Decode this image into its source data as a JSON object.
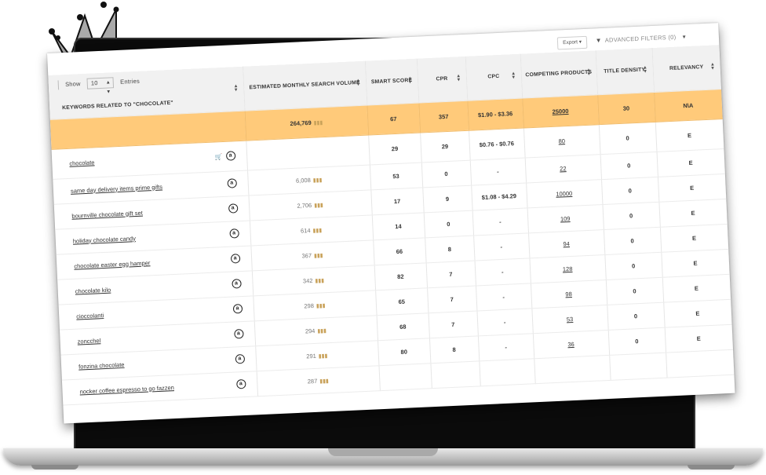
{
  "toolbar": {
    "export_label": "Export",
    "advanced_filters_label": "ADVANCED FILTERS (0)"
  },
  "entries": {
    "show_label": "Show",
    "value": "10",
    "suffix_label": "Entries"
  },
  "columns": [
    "KEYWORDS RELATED TO \"CHOCOLATE\"",
    "ESTIMATED MONTHLY SEARCH VOLUME",
    "SMART SCORE",
    "CPR",
    "CPC",
    "COMPETING PRODUCTS",
    "TITLE DENSITY",
    "RELEVANCY"
  ],
  "summary_row": {
    "keyword": "",
    "volume": "264,769",
    "smart_score": "67",
    "cpr": "357",
    "cpc": "$1.90 - $3.36",
    "competing": "25000",
    "title_density": "30",
    "relevancy": "N\\A"
  },
  "rows": [
    {
      "keyword": "chocolate",
      "volume": "",
      "smart_score": "29",
      "cpr": "29",
      "cpc": "$0.76 - $0.76",
      "competing": "80",
      "title_density": "0",
      "relevancy": "E"
    },
    {
      "keyword": "same day delivery items prime gifts",
      "volume": "6,008",
      "smart_score": "53",
      "cpr": "0",
      "cpc": "-",
      "competing": "22",
      "title_density": "0",
      "relevancy": "E"
    },
    {
      "keyword": "bournville chocolate gift set",
      "volume": "2,706",
      "smart_score": "17",
      "cpr": "9",
      "cpc": "$1.08 - $4.29",
      "competing": "10000",
      "title_density": "0",
      "relevancy": "E"
    },
    {
      "keyword": "holiday chocolate candy",
      "volume": "614",
      "smart_score": "14",
      "cpr": "0",
      "cpc": "-",
      "competing": "109",
      "title_density": "0",
      "relevancy": "E"
    },
    {
      "keyword": "chocolate easter egg hamper",
      "volume": "367",
      "smart_score": "66",
      "cpr": "8",
      "cpc": "-",
      "competing": "94",
      "title_density": "0",
      "relevancy": "E"
    },
    {
      "keyword": "chocolate kilo",
      "volume": "342",
      "smart_score": "82",
      "cpr": "7",
      "cpc": "-",
      "competing": "128",
      "title_density": "0",
      "relevancy": "E"
    },
    {
      "keyword": "cioccolanti",
      "volume": "298",
      "smart_score": "65",
      "cpr": "7",
      "cpc": "-",
      "competing": "98",
      "title_density": "0",
      "relevancy": "E"
    },
    {
      "keyword": "zoncchel",
      "volume": "294",
      "smart_score": "68",
      "cpr": "7",
      "cpc": "-",
      "competing": "53",
      "title_density": "0",
      "relevancy": "E"
    },
    {
      "keyword": "fonzina chocolate",
      "volume": "291",
      "smart_score": "80",
      "cpr": "8",
      "cpc": "-",
      "competing": "36",
      "title_density": "0",
      "relevancy": "E"
    },
    {
      "keyword": "nocker coffee espresso to go fazzen",
      "volume": "287",
      "smart_score": "",
      "cpr": "",
      "cpc": "",
      "competing": "",
      "title_density": "",
      "relevancy": ""
    }
  ]
}
